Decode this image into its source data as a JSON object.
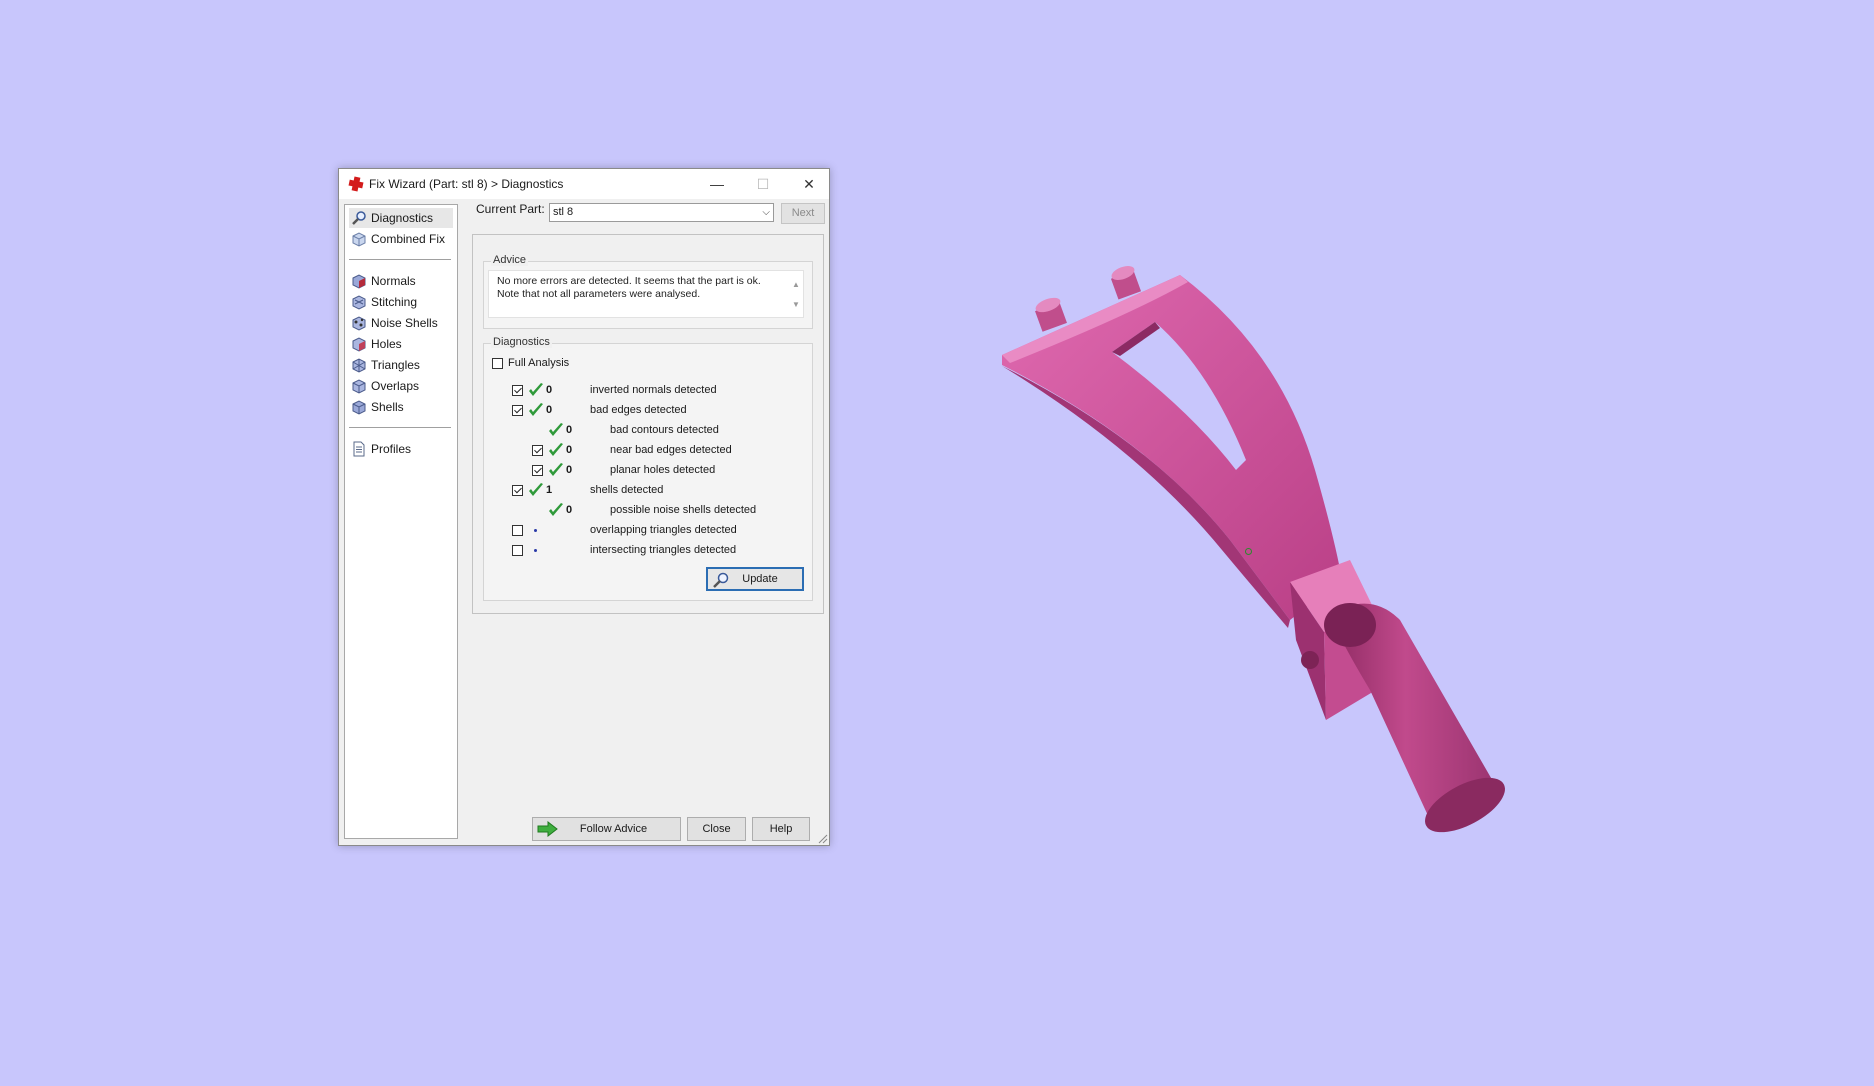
{
  "window": {
    "title": "Fix Wizard (Part: stl 8) > Diagnostics",
    "min_glyph": "—",
    "max_glyph": "☐",
    "close_glyph": "✕"
  },
  "sidebar": {
    "group1": [
      {
        "label": "Diagnostics",
        "icon": "magnifier-icon"
      },
      {
        "label": "Combined Fix",
        "icon": "cube-icon"
      }
    ],
    "group2": [
      {
        "label": "Normals",
        "icon": "normals-cube-icon"
      },
      {
        "label": "Stitching",
        "icon": "stitching-cube-icon"
      },
      {
        "label": "Noise Shells",
        "icon": "noise-shells-icon"
      },
      {
        "label": "Holes",
        "icon": "holes-cube-icon"
      },
      {
        "label": "Triangles",
        "icon": "triangles-cube-icon"
      },
      {
        "label": "Overlaps",
        "icon": "overlaps-cube-icon"
      },
      {
        "label": "Shells",
        "icon": "shells-cube-icon"
      }
    ],
    "group3": [
      {
        "label": "Profiles",
        "icon": "document-icon"
      }
    ]
  },
  "current_part": {
    "label": "Current Part:",
    "value": "stl 8",
    "next_label": "Next"
  },
  "advice": {
    "title": "Advice",
    "line1": "No more errors are detected. It seems that the part is ok.",
    "line2": "Note that not all parameters were analysed."
  },
  "diagnostics": {
    "title": "Diagnostics",
    "full_analysis_label": "Full Analysis",
    "full_analysis_checked": false,
    "rows": [
      {
        "checkbox": true,
        "checked": true,
        "status": "ok",
        "count": "0",
        "label": "inverted normals detected",
        "indent": 0
      },
      {
        "checkbox": true,
        "checked": true,
        "status": "ok",
        "count": "0",
        "label": "bad edges detected",
        "indent": 0
      },
      {
        "checkbox": false,
        "checked": false,
        "status": "ok",
        "count": "0",
        "label": "bad contours detected",
        "indent": 1
      },
      {
        "checkbox": true,
        "checked": true,
        "status": "ok",
        "count": "0",
        "label": "near bad edges detected",
        "indent": 1
      },
      {
        "checkbox": true,
        "checked": true,
        "status": "ok",
        "count": "0",
        "label": "planar holes detected",
        "indent": 1
      },
      {
        "checkbox": true,
        "checked": true,
        "status": "ok",
        "count": "1",
        "label": "shells detected",
        "indent": 0
      },
      {
        "checkbox": false,
        "checked": false,
        "status": "ok",
        "count": "0",
        "label": "possible noise shells detected",
        "indent": 1
      },
      {
        "checkbox": true,
        "checked": false,
        "status": "pending",
        "count": "",
        "label": "overlapping triangles detected",
        "indent": 0
      },
      {
        "checkbox": true,
        "checked": false,
        "status": "pending",
        "count": "",
        "label": "intersecting triangles detected",
        "indent": 0
      }
    ],
    "update_label": "Update"
  },
  "buttons": {
    "follow_advice": "Follow Advice",
    "close": "Close",
    "help": "Help"
  },
  "colors": {
    "background": "#c8c6fc",
    "model": "#d0509a",
    "check_green": "#2f9a3a"
  }
}
